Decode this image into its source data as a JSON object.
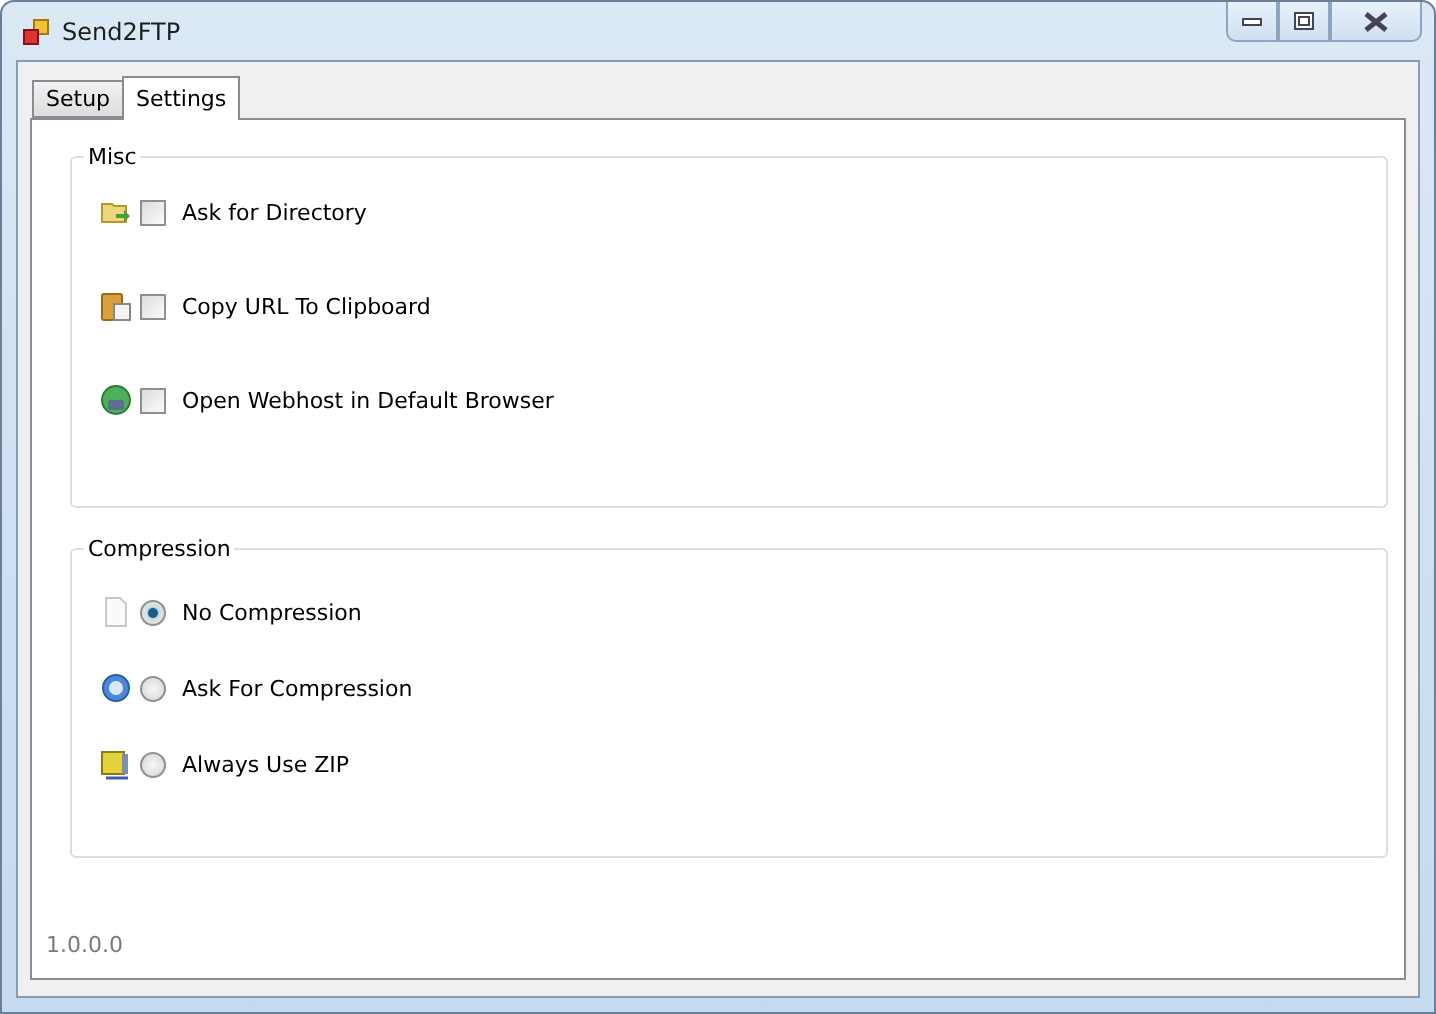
{
  "window": {
    "title": "Send2FTP"
  },
  "tabs": [
    {
      "label": "Setup",
      "selected": false
    },
    {
      "label": "Settings",
      "selected": true
    }
  ],
  "groups": [
    {
      "title": "Misc",
      "kind": "checkbox",
      "items": [
        {
          "label": "Ask for Directory",
          "checked": false
        },
        {
          "label": "Copy URL To Clipboard",
          "checked": false
        },
        {
          "label": "Open Webhost in Default Browser",
          "checked": false
        }
      ]
    },
    {
      "title": "Compression",
      "kind": "radio",
      "items": [
        {
          "label": "No Compression",
          "selected": true
        },
        {
          "label": "Ask For Compression",
          "selected": false
        },
        {
          "label": "Always Use ZIP",
          "selected": false
        }
      ]
    }
  ],
  "version": "1.0.0.0"
}
